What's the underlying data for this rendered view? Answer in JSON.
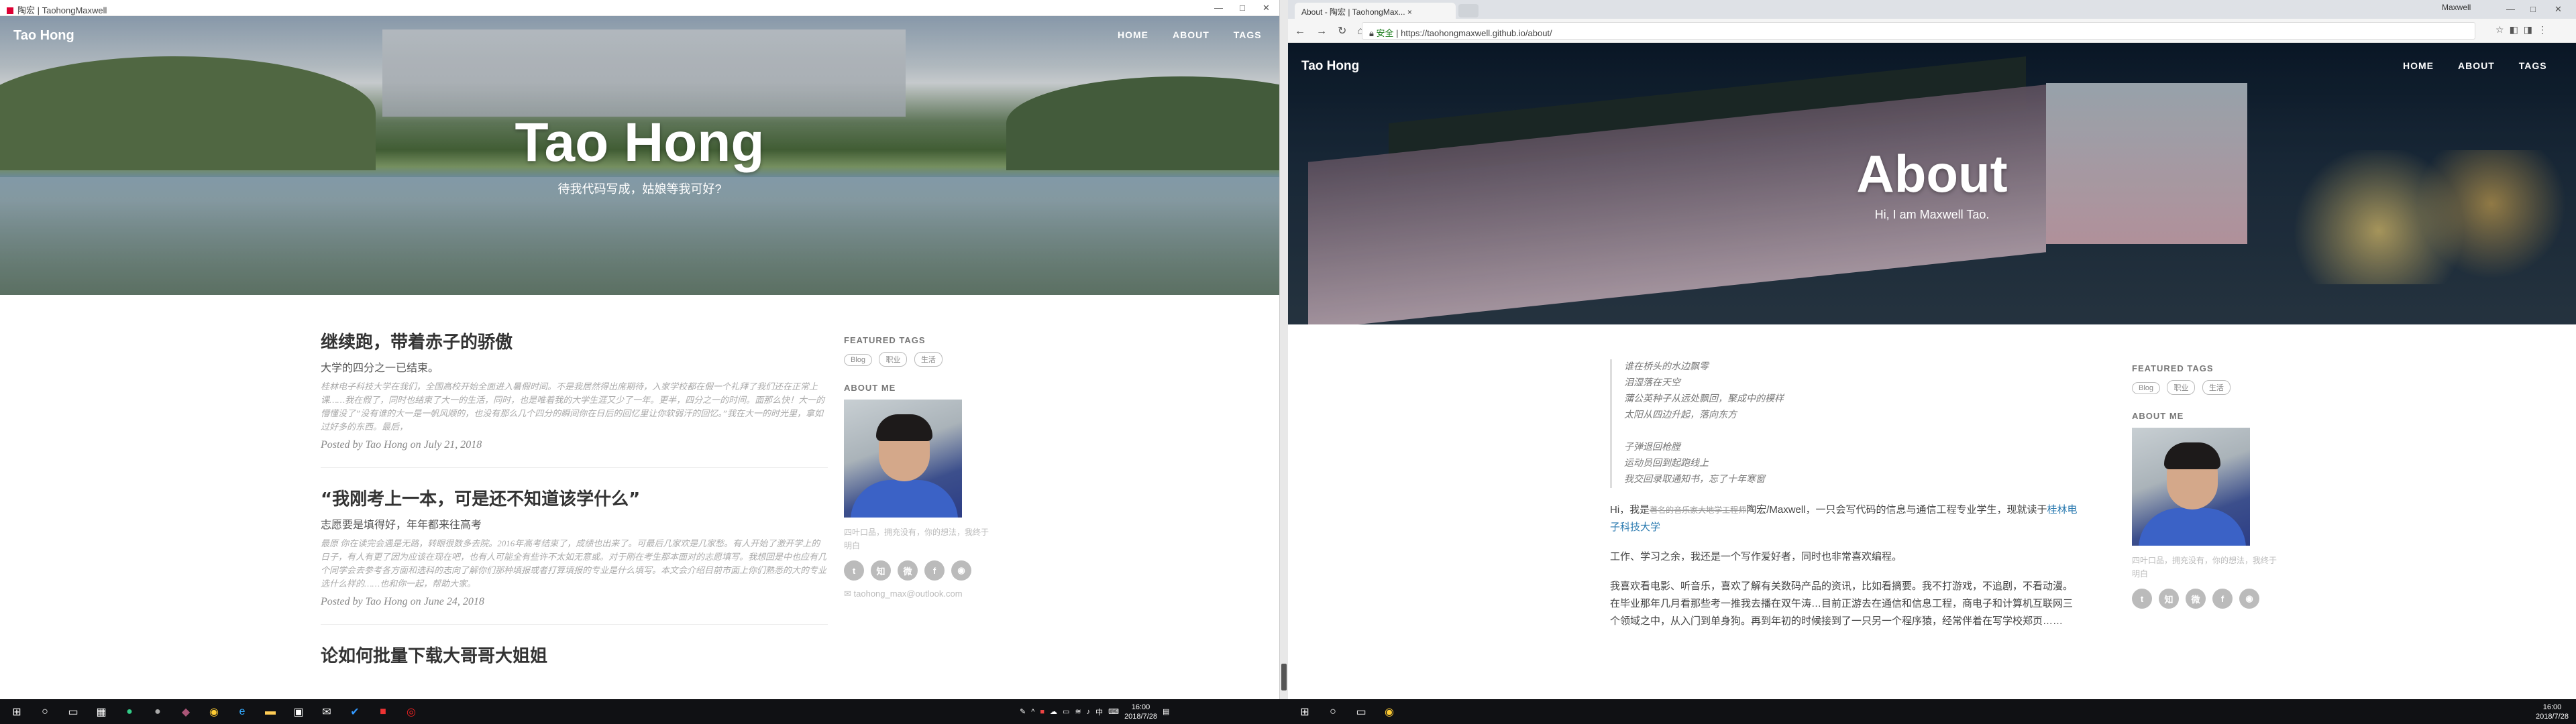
{
  "left": {
    "window_title": "陶宏 | TaohongMaxwell",
    "brand": "Tao Hong",
    "nav": [
      "HOME",
      "ABOUT",
      "TAGS"
    ],
    "hero_title": "Tao Hong",
    "hero_subtitle": "待我代码写成，姑娘等我可好?",
    "posts": [
      {
        "title": "继续跑，带着赤子的骄傲",
        "subtitle": "大学的四分之一已结束。",
        "excerpt": "桂林电子科技大学在我们，全国高校开始全面进入暑假时间。不是我居然得出席期待，入家学校都在假一个礼拜了我们还在正常上课……我在假了，同时也结束了大一的生活，同时，也是唯着我的大学生涯又少了一年。更半，四分之一的时间。面那么快！大一的懵懂没了”没有谁的大一是一帆风顺的，也没有那么几个四分的瞬间你在日后的回忆里让你软弱汗的回忆。”我在大一的时光里，拿如过好多的东西。最后，",
        "meta": "Posted by Tao Hong on July 21, 2018"
      },
      {
        "title": "“我刚考上一本，可是还不知道该学什么”",
        "subtitle": "志愿要是填得好，年年都来往高考",
        "excerpt": "最原 你在读完会遇是无路，转眼很数多去院。2016年高考结束了，成绩也出来了。可最后几家欢是几家愁。有人开始了激开学上的日子，有人有更了因为应该在现在吧，也有人可能全有些许不太如无意或。对于刚在考生那本面对的志愿填写。我想回是中也应有几个同学会去参考各方面和选科的志向了解你们那种填报或者打算填报的专业是什么填写。本文会介绍目前市面上你们熟悉的大的专业选什么样的……也和你一起，帮助大家。",
        "meta": "Posted by Tao Hong on June 24, 2018"
      },
      {
        "title": "论如何批量下载大哥哥大姐姐",
        "subtitle": "",
        "excerpt": "",
        "meta": ""
      }
    ],
    "sidebar": {
      "featured_tags_title": "FEATURED TAGS",
      "tags": [
        "Blog",
        "职业",
        "生活"
      ],
      "about_title": "ABOUT ME",
      "about_text": "四叶口品，拥充没有，你的想法，我终于明白",
      "socials": [
        "twitter",
        "zhihu",
        "weibo",
        "facebook",
        "github"
      ],
      "email": "taohong_max@outlook.com"
    },
    "taskbar": {
      "time": "16:00",
      "date": "2018/7/28"
    }
  },
  "right": {
    "tab_title": "About - 陶宏 | TaohongMax...",
    "address_secure": "安全",
    "address_url": "https://taohongmaxwell.github.io/about/",
    "profile_name": "Maxwell",
    "brand": "Tao Hong",
    "nav": [
      "HOME",
      "ABOUT",
      "TAGS"
    ],
    "hero_title": "About",
    "hero_subtitle": "Hi, I am Maxwell Tao.",
    "quote1": [
      "谁在桥头的水边飘零",
      "泪湿落在天空",
      "蒲公英种子从远处飘回，聚成中的模样",
      "太阳从四边升起，落向东方"
    ],
    "quote2": [
      "子弹退回枪膛",
      "运动员回到起跑线上",
      "我交回录取通知书，忘了十年寒窗"
    ],
    "para1_a": "Hi，我是",
    "para1_strike": "著名的音乐家大地学工程师",
    "para1_b": "陶宏/Maxwell，一只会写代码的信息与通信工程专业学生，现就读于",
    "para1_link": "桂林电子科技大学",
    "para2": "工作、学习之余，我还是一个写作爱好者，同时也非常喜欢编程。",
    "para3": "我喜欢看电影、听音乐，喜欢了解有关数码产品的资讯，比如看摘要。我不打游戏，不追剧，不看动漫。在毕业那年几月看那些考一推我去播在双午涛…目前正游去在通信和信息工程，商电子和计算机互联网三个领域之中，从入门到单身狗。再到年初的时候接到了一只另一个程序猿，经常伴着在写学校郑页……",
    "sidebar": {
      "featured_tags_title": "FEATURED TAGS",
      "tags": [
        "Blog",
        "职业",
        "生活"
      ],
      "about_title": "ABOUT ME",
      "about_text": "四叶口品，拥充没有，你的想法，我终于明白",
      "socials": [
        "twitter",
        "zhihu",
        "weibo",
        "facebook",
        "github"
      ]
    },
    "taskbar": {
      "time": "16:00",
      "date": "2018/7/28"
    }
  }
}
